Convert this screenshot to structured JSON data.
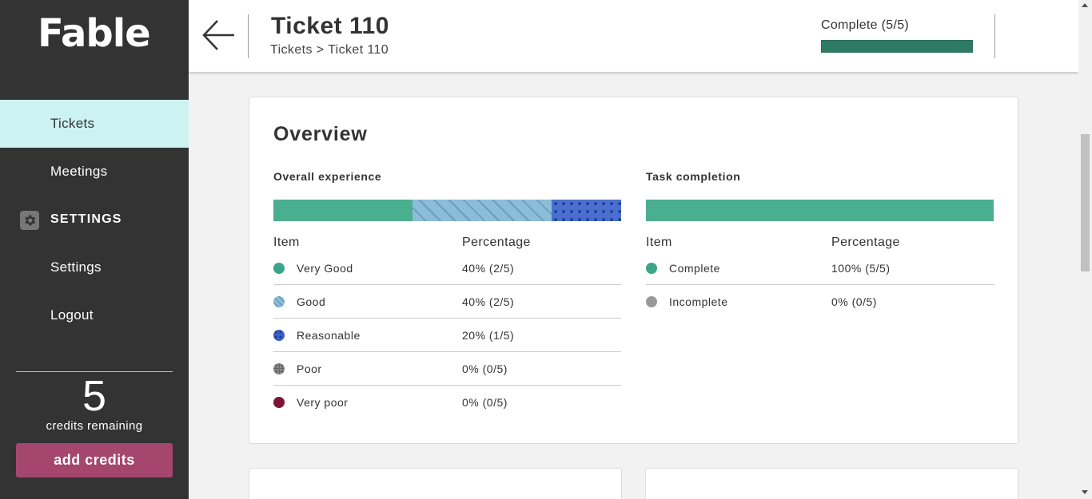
{
  "sidebar": {
    "logo": "Fable",
    "items": [
      {
        "label": "Tickets"
      },
      {
        "label": "Meetings"
      },
      {
        "label": "SETTINGS"
      },
      {
        "label": "Settings"
      },
      {
        "label": "Logout"
      }
    ],
    "credits": {
      "count": "5",
      "label": "credits remaining",
      "button": "add credits"
    }
  },
  "header": {
    "title": "Ticket 110",
    "breadcrumb": {
      "parent": "Tickets",
      "separator": ">",
      "current": "Ticket 110"
    },
    "status": {
      "text": "Complete (5/5)",
      "progress": 1.0
    }
  },
  "overview": {
    "title": "Overview",
    "experience": {
      "label": "Overall experience",
      "col_item": "Item",
      "col_pct": "Percentage",
      "rows": [
        {
          "label": "Very Good",
          "pct": "40% (2/5)",
          "share": 0.4
        },
        {
          "label": "Good",
          "pct": "40% (2/5)",
          "share": 0.4
        },
        {
          "label": "Reasonable",
          "pct": "20% (1/5)",
          "share": 0.2
        },
        {
          "label": "Poor",
          "pct": "0% (0/5)",
          "share": 0
        },
        {
          "label": "Very poor",
          "pct": "0% (0/5)",
          "share": 0
        }
      ]
    },
    "task": {
      "label": "Task completion",
      "col_item": "Item",
      "col_pct": "Percentage",
      "rows": [
        {
          "label": "Complete",
          "pct": "100% (5/5)",
          "share": 1.0
        },
        {
          "label": "Incomplete",
          "pct": "0% (0/5)",
          "share": 0
        }
      ]
    }
  },
  "colors": {
    "sidebar_bg": "#333333",
    "active_nav": "#ccf2f2",
    "accent_green": "#4aaf8f",
    "add_credits": "#a5466e",
    "very_poor": "#7d1438"
  },
  "icons": [
    "back-arrow-icon",
    "gear-icon"
  ]
}
